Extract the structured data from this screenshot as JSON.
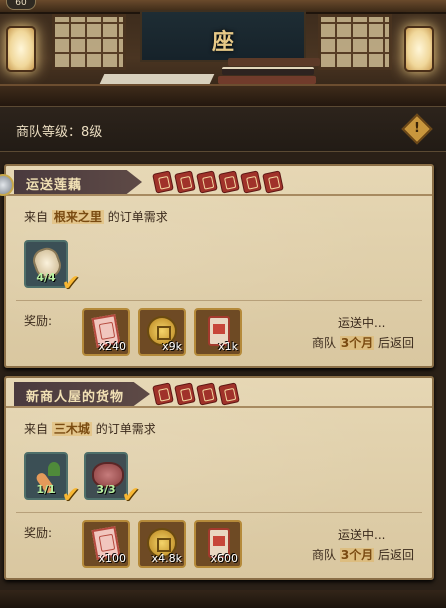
{
  "top": {
    "level_badge": "60",
    "banner_char": "座"
  },
  "caravan": {
    "level_label": "商队等级：8级"
  },
  "orders": [
    {
      "title": "运送莲藕",
      "demand_prefix": "来自",
      "demand_source": "根来之里",
      "demand_suffix": "的订单需求",
      "requirements": [
        {
          "icon": "lotus-root-icon",
          "count": "4/4",
          "done": true
        }
      ],
      "reward_label": "奖励:",
      "rewards": [
        {
          "icon": "ticket-icon",
          "amount": "x240"
        },
        {
          "icon": "coin-icon",
          "amount": "x9k"
        },
        {
          "icon": "tag-icon",
          "amount": "x1k"
        }
      ],
      "status": "运送中...",
      "return_prefix": "商队",
      "return_time": "3个月",
      "return_suffix": "后返回"
    },
    {
      "title": "新商人屋的货物",
      "demand_prefix": "来自",
      "demand_source": "三木城",
      "demand_suffix": "的订单需求",
      "requirements": [
        {
          "icon": "carrot-icon",
          "count": "1/1",
          "done": true
        },
        {
          "icon": "meat-icon",
          "count": "3/3",
          "done": true
        }
      ],
      "reward_label": "奖励:",
      "rewards": [
        {
          "icon": "ticket-icon",
          "amount": "x100"
        },
        {
          "icon": "coin-icon",
          "amount": "x4.8k"
        },
        {
          "icon": "tag-icon",
          "amount": "x600"
        }
      ],
      "status": "运送中...",
      "return_prefix": "商队",
      "return_time": "3个月",
      "return_suffix": "后返回"
    }
  ],
  "colors": {
    "parchment": "#e6d7b4",
    "title_bg": "#4a3a3e",
    "highlight": "#7a4b11",
    "stamp_red": "#a0322a"
  }
}
